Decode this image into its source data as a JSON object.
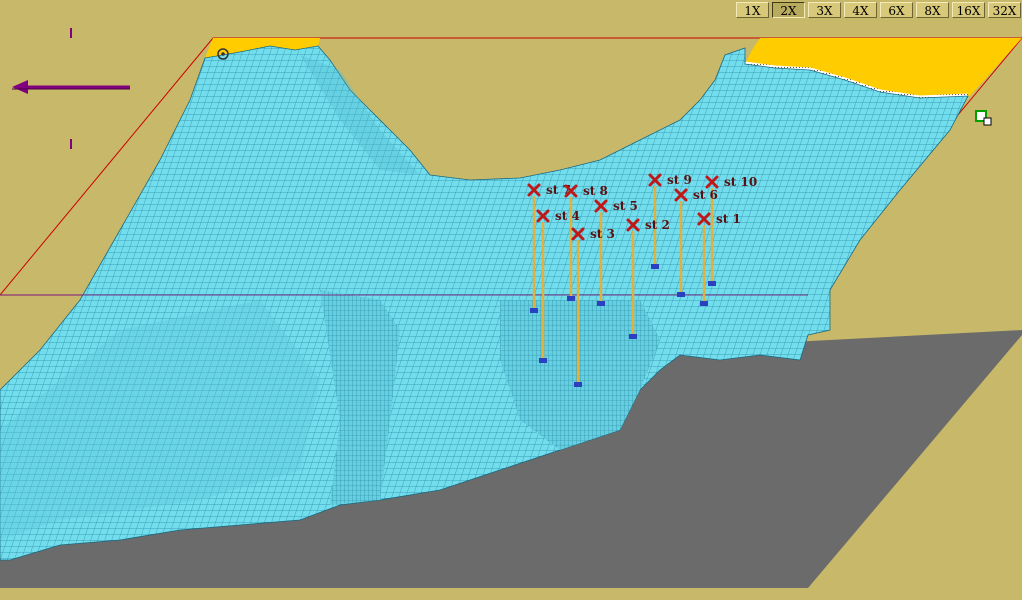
{
  "zoom": {
    "options": [
      "1X",
      "2X",
      "3X",
      "4X",
      "6X",
      "8X",
      "16X",
      "32X"
    ],
    "selected": "2X"
  },
  "compass": {
    "icon": "north-arrow-icon",
    "direction": "left",
    "color": "#800080"
  },
  "corner_handle": {
    "icon": "resize-handle-icon",
    "color": "#00a000"
  },
  "terrain": {
    "water_color": "#6fdcea",
    "mesh_color": "#1a6a80",
    "land_color": "#ffcc00",
    "base_color": "#6b6b6b",
    "frame_color": "#cc0000"
  },
  "stations": [
    {
      "label": "st 7"
    },
    {
      "label": "st 8"
    },
    {
      "label": "st 9"
    },
    {
      "label": "st 10"
    },
    {
      "label": "st 4"
    },
    {
      "label": "st 5"
    },
    {
      "label": "st 6"
    },
    {
      "label": "st 3"
    },
    {
      "label": "st 2"
    },
    {
      "label": "st 1"
    }
  ]
}
